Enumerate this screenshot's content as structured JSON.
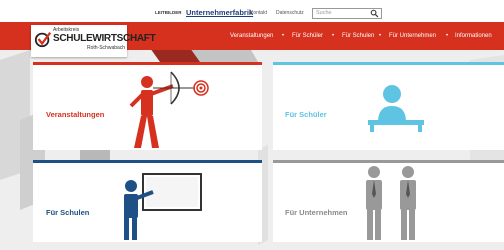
{
  "topbar": {
    "pre_brand": "LEITBILDER",
    "brand": "Unternehmerfabrik",
    "link_1": "Kontakt",
    "link_2": "Datenschutz",
    "search_placeholder": "Suche"
  },
  "logo": {
    "line1": "Arbeitskreis",
    "line2": "SCHULEWIRTSCHAFT",
    "line3": "Roth-Schwabach"
  },
  "nav": {
    "items": [
      "Veranstaltungen",
      "Für Schüler",
      "Für Schulen",
      "Für Unternehmen",
      "Informationen"
    ],
    "separator": "•"
  },
  "tiles": [
    {
      "label": "Veranstaltungen",
      "label_color": "#d6301e",
      "bar_color": "#d6301e"
    },
    {
      "label": "Für Schüler",
      "label_color": "#5fc3e4",
      "bar_color": "#5fc3e4"
    },
    {
      "label": "Für Schulen",
      "label_color": "#1e4f85",
      "bar_color": "#1e4f85"
    },
    {
      "label": "Für Unternehmen",
      "label_color": "#8a8a8a",
      "bar_color": "#999999"
    }
  ],
  "icons": {
    "archer": "archer-icon",
    "student": "student-desk-icon",
    "teacher": "teacher-board-icon",
    "business": "businessmen-icon",
    "search": "search-icon",
    "logo_mark": "checkmark-logo-icon"
  }
}
